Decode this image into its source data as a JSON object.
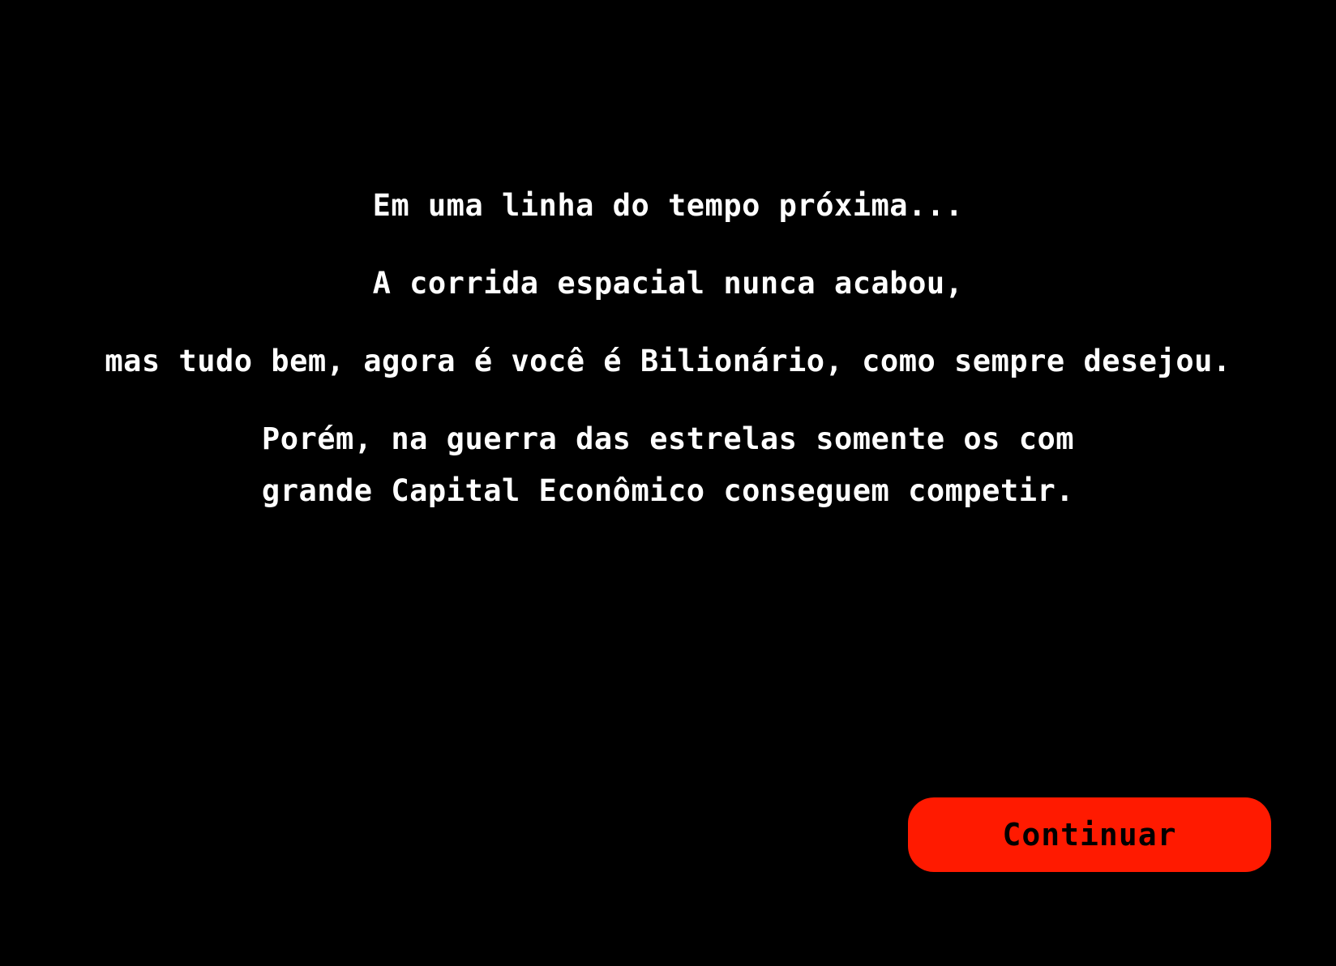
{
  "intro": {
    "line1": "Em uma linha do tempo próxima...",
    "line2": "A corrida espacial nunca acabou,",
    "line3": "mas tudo bem, agora é você é Bilionário, como sempre desejou.",
    "line4a": "Porém, na guerra das estrelas somente os com",
    "line4b": "grande Capital Econômico conseguem competir."
  },
  "actions": {
    "continue_label": "Continuar"
  },
  "colors": {
    "background": "#000000",
    "text": "#ffffff",
    "button": "#ff1a00",
    "button_text": "#000000"
  }
}
